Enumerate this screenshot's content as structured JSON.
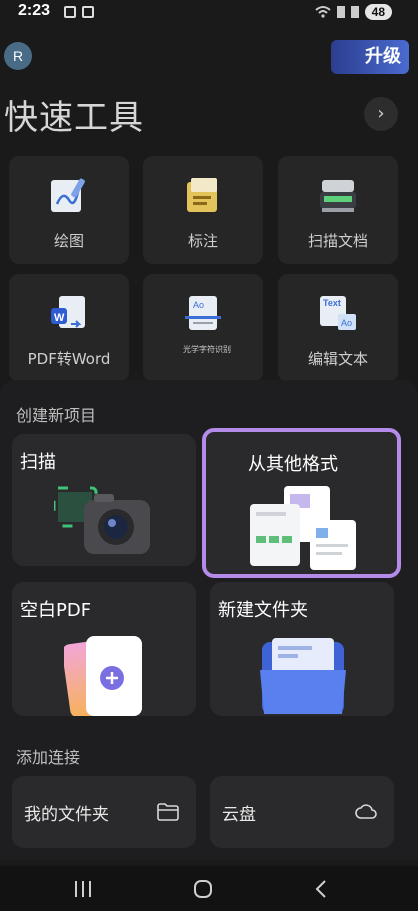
{
  "status_bar": {
    "time": "2:23",
    "battery": "48"
  },
  "header": {
    "avatar_letter": "R",
    "upgrade_label": "升级"
  },
  "quick_tools": {
    "title": "快速工具",
    "items": [
      {
        "label": "绘图",
        "icon": "drawing-icon"
      },
      {
        "label": "标注",
        "icon": "annotation-icon"
      },
      {
        "label": "扫描文档",
        "icon": "scanner-icon"
      },
      {
        "label": "PDF转Word",
        "icon": "pdf-to-word-icon"
      },
      {
        "label": "光学字符识别",
        "icon": "ocr-icon"
      },
      {
        "label": "编辑文本",
        "icon": "edit-text-icon"
      }
    ]
  },
  "create_new": {
    "title": "创建新项目",
    "items": [
      {
        "label": "扫描",
        "icon": "camera-icon"
      },
      {
        "label": "从其他格式",
        "icon": "documents-icon"
      },
      {
        "label": "空白PDF",
        "icon": "blank-pdf-icon"
      },
      {
        "label": "新建文件夹",
        "icon": "folder-icon"
      }
    ]
  },
  "add_connection": {
    "title": "添加连接",
    "items": [
      {
        "label": "我的文件夹",
        "icon": "folder-outline-icon"
      },
      {
        "label": "云盘",
        "icon": "cloud-icon"
      }
    ]
  },
  "colors": {
    "accent": "#b48be8",
    "upgrade": "#3b56b5",
    "background": "#1a1a1b"
  }
}
